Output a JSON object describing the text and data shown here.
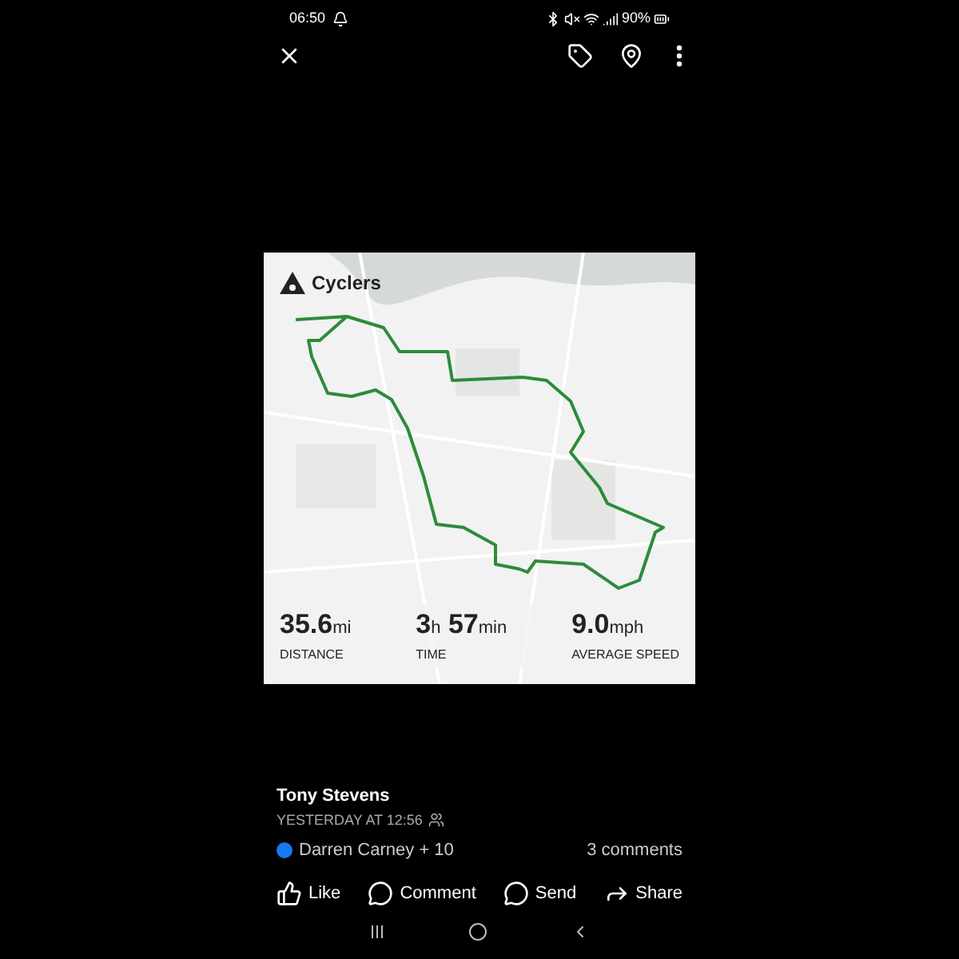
{
  "status_bar": {
    "time": "06:50",
    "battery": "90%"
  },
  "activity": {
    "kind": "picture",
    "brand": "Cyclers",
    "stats": [
      {
        "value": "35.6",
        "unit": "mi",
        "label": "DISTANCE"
      },
      {
        "value": "3",
        "unit": "h",
        "value2": "57",
        "unit2": "min",
        "label": "TIME"
      },
      {
        "value": "9.0",
        "unit": "mph",
        "label": "AVERAGE SPEED"
      }
    ]
  },
  "post": {
    "author": "Tony Stevens",
    "time": "YESTERDAY AT 12:56",
    "reactions": "Darren Carney + 10",
    "comments": "3 comments"
  },
  "actions": [
    {
      "kind": "like",
      "label": "Like"
    },
    {
      "kind": "comment",
      "label": "Comment"
    },
    {
      "kind": "send",
      "label": "Send"
    },
    {
      "kind": "share",
      "label": "Share"
    }
  ]
}
